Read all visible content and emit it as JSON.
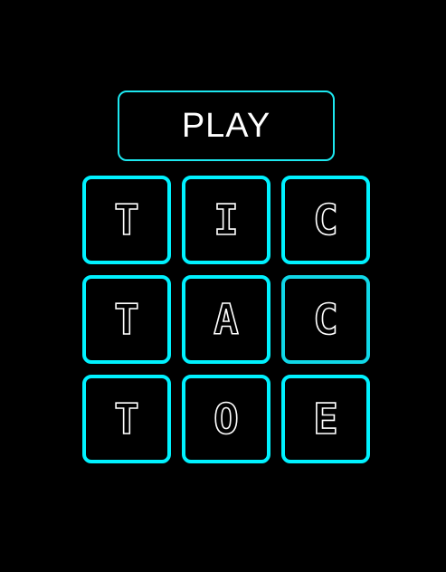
{
  "play_label": "PLAY",
  "accent_color": "#00f2ff",
  "board": [
    [
      "T",
      "I",
      "C"
    ],
    [
      "T",
      "A",
      "C"
    ],
    [
      "T",
      "O",
      "E"
    ]
  ]
}
